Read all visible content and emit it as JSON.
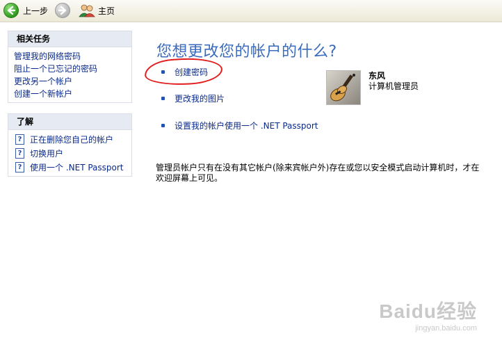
{
  "toolbar": {
    "back_label": "上一步",
    "home_label": "主页"
  },
  "sidebar": {
    "related_tasks": {
      "title": "相关任务",
      "items": [
        {
          "label": "管理我的网络密码"
        },
        {
          "label": "阻止一个已忘记的密码"
        },
        {
          "label": "更改另一个帐户"
        },
        {
          "label": "创建一个新帐户"
        }
      ]
    },
    "learn": {
      "title": "了解",
      "items": [
        {
          "label": "正在删除您自己的帐户",
          "icon": "help-icon"
        },
        {
          "label": "切换用户",
          "icon": "help-icon"
        },
        {
          "label": "使用一个 .NET Passport",
          "icon": "help-icon"
        }
      ]
    }
  },
  "main": {
    "title": "您想更改您的帐户的什么?",
    "options": [
      {
        "label": "创建密码"
      },
      {
        "label": "更改我的图片"
      },
      {
        "label": "设置我的帐户使用一个 .NET Passport"
      }
    ],
    "user": {
      "name": "东风",
      "role": "计算机管理员"
    },
    "note": "管理员帐户只有在没有其它帐户(除来宾帐户外)存在或您以安全模式启动计算机时，才在欢迎屏幕上可见。"
  },
  "watermark": {
    "main": "Baidu经验",
    "sub": "jingyan.baidu.com"
  },
  "colors": {
    "title": "#3a6bbf",
    "link": "#0a2a8a",
    "annotation": "#e21b1b",
    "panel_header": "#e6eaf2"
  }
}
